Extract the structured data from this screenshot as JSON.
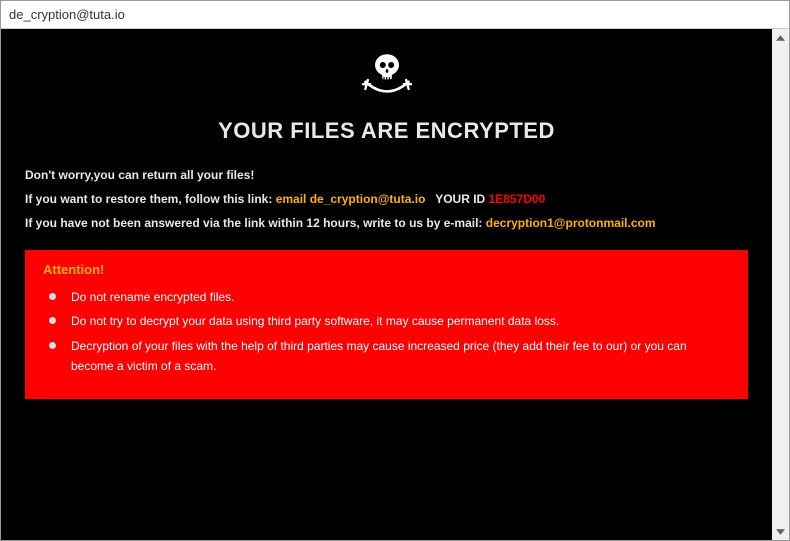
{
  "window": {
    "title": "de_cryption@tuta.io"
  },
  "heading": "YOUR FILES ARE ENCRYPTED",
  "line1": "Don't worry,you can return all your files!",
  "line2_prefix": "If you want to restore them, follow this link: ",
  "line2_email_label": "email de_cryption@tuta.io",
  "line2_yourid_label": "   YOUR ID ",
  "line2_id": "1E857D00",
  "line3_prefix": "If you have not been answered via the link within 12 hours, write to us by e-mail: ",
  "line3_email": "decryption1@protonmail.com",
  "attention": {
    "title": "Attention!",
    "items": [
      "Do not rename encrypted files.",
      "Do not try to decrypt your data using third party software, it may cause permanent data loss.",
      "Decryption of your files with the help of third parties may cause increased price (they add their fee to our) or you can become a victim of a scam."
    ]
  }
}
